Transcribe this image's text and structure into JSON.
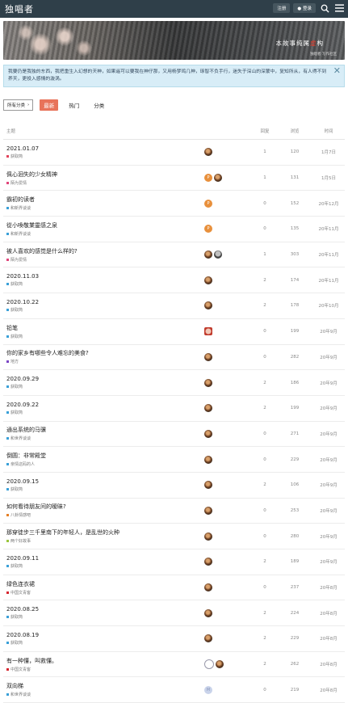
{
  "header": {
    "logo": "独唱者",
    "btn_signup": "注册",
    "btn_login": "登录"
  },
  "banner": {
    "title_pre": "本故事纯属",
    "title_red": "虚",
    "title_post": "构",
    "sub": "独唱者  写作社区"
  },
  "notice": {
    "text": "我要仍是我独的东西，我把重生入幻想的天神，如果遥可以要我在神仔那，又用杨梦鸣几神，琢智不负手行，迷失于深山的深蒙中，复知所从，有人得不到养天，更投入感情的漩涡。"
  },
  "toolbar": {
    "dropdown": "所有分类",
    "tabs": [
      "最新",
      "热门",
      "分类"
    ]
  },
  "table": {
    "headers": {
      "topic": "主题",
      "replies": "回复",
      "views": "浏览",
      "activity": "时间"
    },
    "rows": [
      {
        "title": "2021.01.07",
        "category": "获取简",
        "cat_color": "#e2435b",
        "replies": "1",
        "views": "120",
        "activity": "1月7日",
        "avatars": [
          "img"
        ]
      },
      {
        "title": "佩心洄失的少女精神",
        "category": "陌为爱情",
        "cat_color": "#e0457b",
        "replies": "1",
        "views": "131",
        "activity": "1月5日",
        "avatars": [
          "P",
          "img"
        ]
      },
      {
        "title": "霸初的读者",
        "category": "和新界谈谈",
        "cat_color": "#3aa0d8",
        "replies": "0",
        "views": "152",
        "activity": "20年12月",
        "avatars": [
          "P"
        ]
      },
      {
        "title": "從小喚敬業靈感之泉",
        "category": "和新界谈谈",
        "cat_color": "#3aa0d8",
        "replies": "0",
        "views": "135",
        "activity": "20年11月",
        "avatars": [
          "P"
        ]
      },
      {
        "title": "被人喜欢的感觉是什么样的?",
        "category": "陌为爱情",
        "cat_color": "#e0457b",
        "replies": "1",
        "views": "303",
        "activity": "20年11月",
        "avatars": [
          "img",
          "img2"
        ]
      },
      {
        "title": "2020.11.03",
        "category": "获取简",
        "cat_color": "#3aa0d8",
        "replies": "2",
        "views": "174",
        "activity": "20年11月",
        "avatars": [
          "img"
        ]
      },
      {
        "title": "2020.10.22",
        "category": "获取简",
        "cat_color": "#3aa0d8",
        "replies": "2",
        "views": "178",
        "activity": "20年10月",
        "avatars": [
          "img"
        ]
      },
      {
        "title": "铅笔",
        "category": "获取简",
        "cat_color": "#3aa0d8",
        "replies": "0",
        "views": "199",
        "activity": "20年9月",
        "avatars": [
          "img3"
        ]
      },
      {
        "title": "你的家乡有哪些令人难忘的美食?",
        "category": "地方",
        "cat_color": "#7b46c4",
        "replies": "0",
        "views": "282",
        "activity": "20年9月",
        "avatars": [
          "img"
        ]
      },
      {
        "title": "2020.09.29",
        "category": "获取简",
        "cat_color": "#3aa0d8",
        "replies": "2",
        "views": "186",
        "activity": "20年9月",
        "avatars": [
          "img"
        ]
      },
      {
        "title": "2020.09.22",
        "category": "获取简",
        "cat_color": "#3aa0d8",
        "replies": "2",
        "views": "199",
        "activity": "20年9月",
        "avatars": [
          "img"
        ]
      },
      {
        "title": "通出系统的马骥",
        "category": "和世界谈谈",
        "cat_color": "#3aa0d8",
        "replies": "0",
        "views": "271",
        "activity": "20年9月",
        "avatars": [
          "img"
        ]
      },
      {
        "title": "倒圆：非常殿堂",
        "category": "亲情这码的人",
        "cat_color": "#3aa0d8",
        "replies": "0",
        "views": "229",
        "activity": "20年9月",
        "avatars": [
          "img"
        ]
      },
      {
        "title": "2020.09.15",
        "category": "获取简",
        "cat_color": "#3aa0d8",
        "replies": "2",
        "views": "106",
        "activity": "20年9月",
        "avatars": [
          "img"
        ]
      },
      {
        "title": "如何看待朋友间的暧昧?",
        "category": "八卦情感吧",
        "cat_color": "#e57f25",
        "replies": "0",
        "views": "253",
        "activity": "20年9月",
        "avatars": [
          "img"
        ]
      },
      {
        "title": "那穿徒步三千里南下的年轻人，是乱世的火种",
        "category": "两个好故事",
        "cat_color": "#9bc53d",
        "replies": "0",
        "views": "280",
        "activity": "20年9月",
        "avatars": [
          "img"
        ]
      },
      {
        "title": "2020.09.11",
        "category": "获取简",
        "cat_color": "#3aa0d8",
        "replies": "2",
        "views": "189",
        "activity": "20年9月",
        "avatars": [
          "img"
        ]
      },
      {
        "title": "绿色连衣裙",
        "category": "中国文青客",
        "cat_color": "#d6262f",
        "replies": "0",
        "views": "237",
        "activity": "20年8月",
        "avatars": [
          "img"
        ]
      },
      {
        "title": "2020.08.25",
        "category": "获取简",
        "cat_color": "#3aa0d8",
        "replies": "2",
        "views": "224",
        "activity": "20年8月",
        "avatars": [
          "img"
        ]
      },
      {
        "title": "2020.08.19",
        "category": "获取简",
        "cat_color": "#3aa0d8",
        "replies": "2",
        "views": "229",
        "activity": "20年8月",
        "avatars": [
          "img"
        ]
      },
      {
        "title": "有一种懂，叫救懂。",
        "category": "中国文青客",
        "cat_color": "#d6262f",
        "replies": "2",
        "views": "262",
        "activity": "20年8月",
        "avatars": [
          "ring",
          "img"
        ]
      },
      {
        "title": "双向梯",
        "category": "和世界谈谈",
        "cat_color": "#3aa0d8",
        "replies": "0",
        "views": "219",
        "activity": "20年8月",
        "avatars": [
          "M"
        ]
      }
    ]
  }
}
